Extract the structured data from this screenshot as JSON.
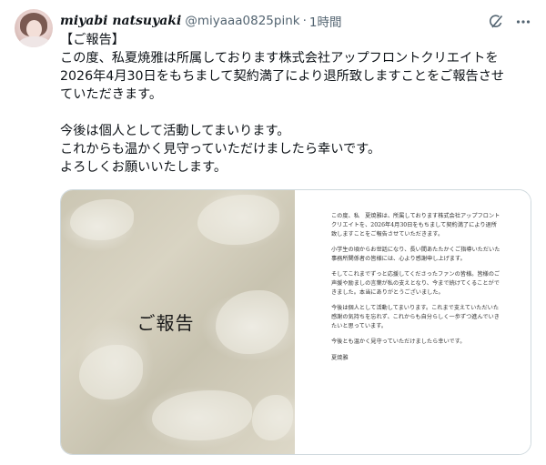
{
  "user": {
    "display_name": "miyabi natsuyaki",
    "handle": "@miyaaa0825pink",
    "separator": "·",
    "time": "1時間"
  },
  "icons": {
    "grok": "grok-icon",
    "more": "more-icon"
  },
  "tweet": {
    "lines": [
      "【ご報告】",
      "この度、私夏焼雅は所属しております株式会社アップフロントクリエイトを",
      "2026年4月30日をもちまして契約満了により退所致しますことをご報告させ",
      "ていただきます。",
      "",
      "今後は個人として活動してまいります。",
      "これからも温かく見守っていただけましたら幸いです。",
      "よろしくお願いいたします。"
    ]
  },
  "media": {
    "image_title": "ご報告",
    "letter": {
      "paragraphs": [
        "この度、私　夏焼雅は、所属しております株式会社アップフロントクリエイトを、2026年4月30日をもちまして契約満了により退所致しますことをご報告させていただきます。",
        "小学生の頃からお世話になり、長い間あたたかくご指導いただいた事務所関係者の皆様には、心より感謝申し上げます。",
        "そしてこれまでずっと応援してくださったファンの皆様。皆様のご声援や励ましの言葉が私の支えとなり、今まで続けてくることができました。本当にありがとうございました。",
        "今後は個人として活動してまいります。これまで支えていただいた感謝の気持ちを忘れず、これからも自分らしく一歩ずつ進んでいきたいと思っています。",
        "今後とも温かく見守っていただけましたら幸いです。"
      ],
      "signature": "夏焼雅"
    }
  },
  "colors": {
    "text_primary": "#0f1419",
    "text_secondary": "#536471",
    "border": "#cfd9de"
  }
}
